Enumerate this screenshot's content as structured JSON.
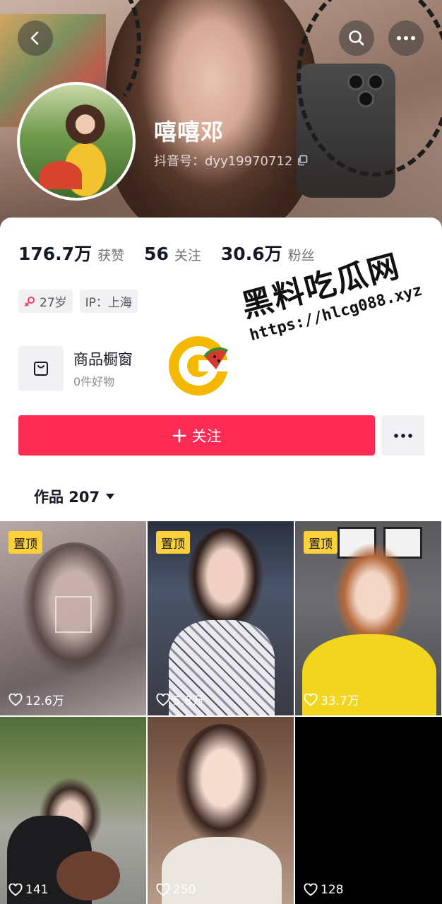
{
  "profile": {
    "nickname": "嘻嘻邓",
    "douyin_id": "抖音号：dyy19970712"
  },
  "stats": [
    {
      "value": "176.7万",
      "label": "获赞"
    },
    {
      "value": "56",
      "label": "关注"
    },
    {
      "value": "30.6万",
      "label": "粉丝"
    }
  ],
  "tags": {
    "age": "27岁",
    "ip": "IP：上海"
  },
  "shop": {
    "title": "商品橱窗",
    "subtitle": "0件好物"
  },
  "actions": {
    "follow_label": "关注"
  },
  "works_tab": {
    "label": "作品 207"
  },
  "watermark": {
    "title": "黑料吃瓜网",
    "url": "https://hlcg088.xyz"
  },
  "videos": [
    {
      "pinned": true,
      "pin_label": "置顶",
      "likes": "12.6万"
    },
    {
      "pinned": true,
      "pin_label": "置顶",
      "likes": "5.8万"
    },
    {
      "pinned": true,
      "pin_label": "置顶",
      "likes": "33.7万"
    },
    {
      "pinned": false,
      "likes": "141"
    },
    {
      "pinned": false,
      "likes": "250"
    },
    {
      "pinned": false,
      "likes": "128"
    }
  ],
  "icons": {
    "back": "back-arrow-icon",
    "search": "search-icon",
    "more": "more-icon",
    "copy": "copy-icon",
    "gender": "female-icon",
    "shop": "shopping-bag-icon",
    "follow": "plus-icon",
    "dropdown": "caret-down-icon",
    "likes": "heart-outline-icon"
  },
  "colors": {
    "accent": "#fe2c55",
    "pin_badge": "#fbd13b",
    "gender": "#fe2c55"
  }
}
